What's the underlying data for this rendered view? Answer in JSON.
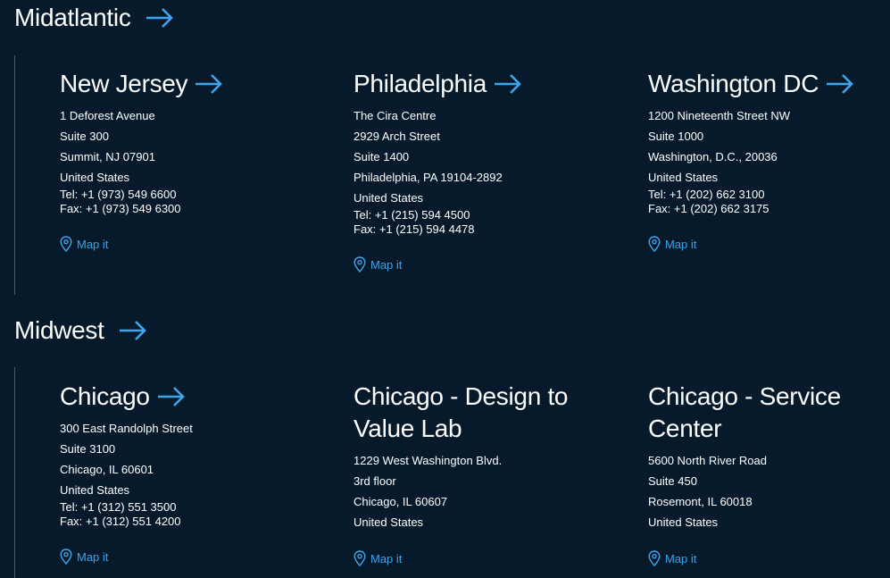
{
  "colors": {
    "background": "#061a2b",
    "accent": "#3ea4ec",
    "text": "#ffffff",
    "divider": "#4c5b69"
  },
  "regions": [
    {
      "title": "Midatlantic",
      "offices": [
        {
          "name": "New Jersey",
          "has_arrow": true,
          "address": [
            "1 Deforest Avenue",
            "Suite 300",
            "Summit, NJ 07901",
            "United States"
          ],
          "tel": "Tel: +1 (973) 549 6600",
          "fax": "Fax: +1 (973) 549 6300",
          "map_label": "Map it",
          "map_icon": "map-pin-icon"
        },
        {
          "name": "Philadelphia",
          "has_arrow": true,
          "address": [
            "The Cira Centre",
            "2929 Arch Street",
            "Suite 1400",
            "Philadelphia, PA 19104-2892",
            "United States"
          ],
          "tel": "Tel: +1 (215) 594 4500",
          "fax": "Fax: +1 (215) 594 4478",
          "map_label": "Map it",
          "map_icon": "map-pin-icon"
        },
        {
          "name": "Washington DC",
          "has_arrow": true,
          "address": [
            "1200 Nineteenth Street NW",
            "Suite 1000",
            "Washington, D.C., 20036",
            "United States"
          ],
          "tel": "Tel: +1 (202) 662 3100",
          "fax": "Fax: +1 (202) 662 3175",
          "map_label": "Map it",
          "map_icon": "map-pin-icon"
        }
      ]
    },
    {
      "title": "Midwest",
      "offices": [
        {
          "name": "Chicago",
          "has_arrow": true,
          "address": [
            "300 East Randolph Street",
            "Suite 3100",
            "Chicago, IL 60601",
            "United States"
          ],
          "tel": "Tel: +1 (312) 551 3500",
          "fax": "Fax: +1 (312) 551 4200",
          "map_label": "Map it",
          "map_icon": "map-pin-icon"
        },
        {
          "name": "Chicago - Design to Value Lab",
          "has_arrow": false,
          "address": [
            "1229 West Washington Blvd.",
            "3rd floor",
            "Chicago, IL 60607",
            "United States"
          ],
          "map_label": "Map it",
          "map_icon": "map-pin-icon"
        },
        {
          "name": "Chicago - Service Center",
          "has_arrow": false,
          "address": [
            "5600 North River Road",
            "Suite 450",
            "Rosemont, IL 60018",
            "United States"
          ],
          "map_label": "Map it",
          "map_icon": "map-pin-icon"
        }
      ]
    }
  ]
}
